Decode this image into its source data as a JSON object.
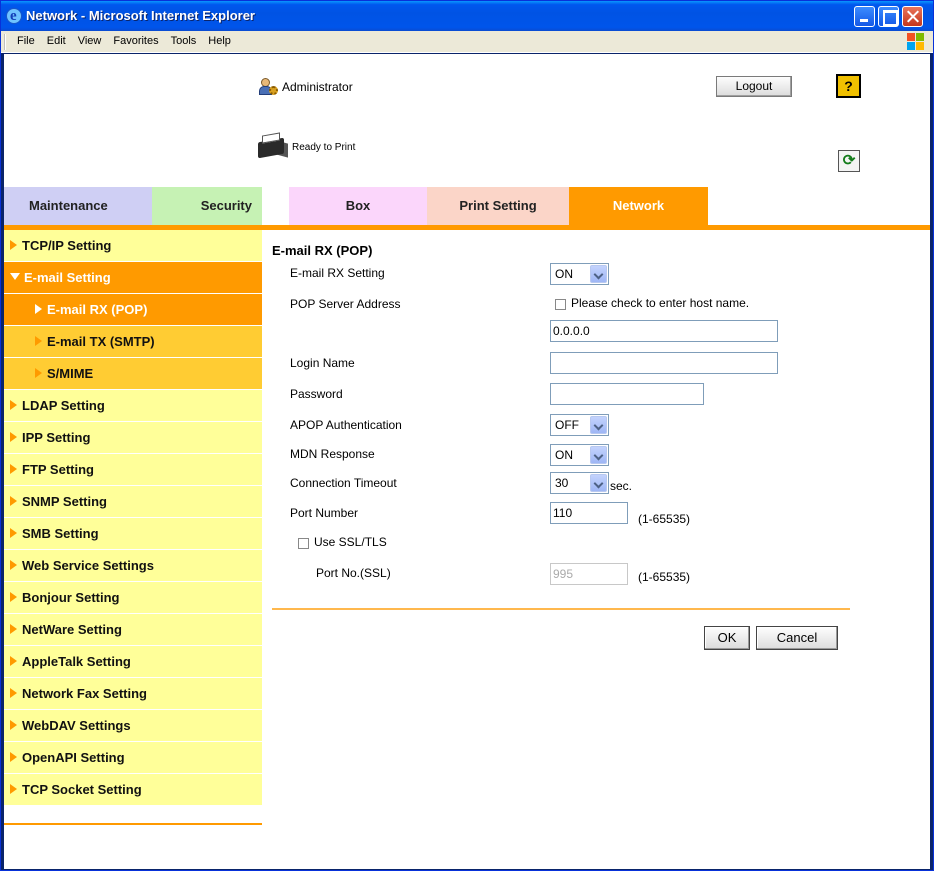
{
  "window": {
    "title": "Network - Microsoft Internet Explorer",
    "menu": [
      "File",
      "Edit",
      "View",
      "Favorites",
      "Tools",
      "Help"
    ]
  },
  "header": {
    "user": "Administrator",
    "logout_label": "Logout",
    "help_label": "?",
    "status": "Ready to Print",
    "refresh_icon": "refresh-icon"
  },
  "tabs": [
    {
      "label": "Maintenance",
      "color": "#cfcff4"
    },
    {
      "label": "Security",
      "color": "#c6f2b4"
    },
    {
      "label": "Box",
      "color": "#fbd6fb"
    },
    {
      "label": "Print Setting",
      "color": "#fbd5c8"
    },
    {
      "label": "Network",
      "color": "#ff9a00",
      "active": true
    }
  ],
  "sidebar": {
    "items": [
      {
        "label": "TCP/IP Setting"
      },
      {
        "label": "E-mail Setting",
        "expanded": true
      },
      {
        "label": "E-mail RX (POP)",
        "sub": true,
        "active": true
      },
      {
        "label": "E-mail TX (SMTP)",
        "sub": true
      },
      {
        "label": "S/MIME",
        "sub": true
      },
      {
        "label": "LDAP Setting"
      },
      {
        "label": "IPP Setting"
      },
      {
        "label": "FTP Setting"
      },
      {
        "label": "SNMP Setting"
      },
      {
        "label": "SMB Setting"
      },
      {
        "label": "Web Service Settings"
      },
      {
        "label": "Bonjour Setting"
      },
      {
        "label": "NetWare Setting"
      },
      {
        "label": "AppleTalk Setting"
      },
      {
        "label": "Network Fax Setting"
      },
      {
        "label": "WebDAV Settings"
      },
      {
        "label": "OpenAPI Setting"
      },
      {
        "label": "TCP Socket Setting"
      }
    ]
  },
  "form": {
    "title": "E-mail RX (POP)",
    "rx_setting": {
      "label": "E-mail RX Setting",
      "value": "ON"
    },
    "pop_server": {
      "label": "POP Server Address",
      "checkbox_label": "Please check to enter host name.",
      "value": "0.0.0.0"
    },
    "login_name": {
      "label": "Login Name",
      "value": ""
    },
    "password": {
      "label": "Password",
      "value": ""
    },
    "apop": {
      "label": "APOP Authentication",
      "value": "OFF"
    },
    "mdn": {
      "label": "MDN Response",
      "value": "ON"
    },
    "timeout": {
      "label": "Connection Timeout",
      "value": "30",
      "unit": "sec."
    },
    "port": {
      "label": "Port Number",
      "value": "110",
      "range": "(1-65535)"
    },
    "ssl": {
      "label": "Use SSL/TLS"
    },
    "ssl_port": {
      "label": "Port No.(SSL)",
      "value": "995",
      "range": "(1-65535)"
    },
    "ok_label": "OK",
    "cancel_label": "Cancel"
  }
}
